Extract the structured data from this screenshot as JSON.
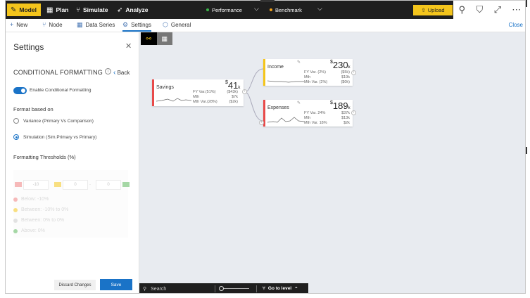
{
  "toolbar": {
    "model": "Model",
    "plan": "Plan",
    "simulate": "Simulate",
    "analyze": "Analyze",
    "performance": "Performance",
    "benchmark": "Benchmark",
    "upload": "Upload",
    "colors": {
      "accent": "#f4c51c",
      "performance_dot": "#3bb54a",
      "benchmark_dot": "#f4a21c"
    }
  },
  "window_icons": [
    "pin-icon",
    "filter-icon",
    "expand-icon",
    "more-icon"
  ],
  "subbar": {
    "new": "New",
    "node": "Node",
    "data_series": "Data Series",
    "settings": "Settings",
    "general": "General",
    "close": "Close"
  },
  "panel": {
    "title": "Settings",
    "section_title": "CONDITIONAL FORMATTING",
    "back": "Back",
    "enable_label": "Enable Conditional Formatting",
    "format_based_on": "Format based on",
    "option_variance": "Variance (Primary Vs Comparison)",
    "option_simulation": "Simulation (Sim.Primary vs Primary)",
    "thresholds_label": "Formatting Thresholds (%)",
    "threshold_inputs": [
      "-10",
      "0",
      "0"
    ],
    "legend": [
      "Below: -10%",
      "Between: -10% to 0%",
      "Between: 0% to 0%",
      "Above: 0%"
    ],
    "legend_colors": [
      "#f08080",
      "#f4c51c",
      "#cccccc",
      "#5cb85c"
    ],
    "discard": "Discard Changes",
    "save": "Save"
  },
  "nodes": {
    "savings": {
      "label": "Savings",
      "value": "41",
      "unit": "k",
      "currency": "$",
      "rows": [
        [
          "FY Var.(51%)",
          "($43k)"
        ],
        [
          "Mth",
          "$7k"
        ],
        [
          "Mth Var.(28%)",
          "($2k)"
        ]
      ],
      "bar_color": "#e84a4a"
    },
    "income": {
      "label": "Income",
      "value": "230",
      "unit": "k",
      "currency": "$",
      "rows": [
        [
          "FY Var. (2%)",
          "($5k)"
        ],
        [
          "Mth",
          "$19k"
        ],
        [
          "Mth Var. (2%)",
          "($0k)"
        ]
      ],
      "bar_color": "#f4c51c"
    },
    "expenses": {
      "label": "Expenses",
      "value": "189",
      "unit": "k",
      "currency": "$",
      "rows": [
        [
          "FY Var. 24%",
          "$37k"
        ],
        [
          "Mth",
          "$13k"
        ],
        [
          "Mth Var. 18%",
          "$2k"
        ]
      ],
      "bar_color": "#e84a4a"
    }
  },
  "bottombar": {
    "search_placeholder": "Search",
    "go_to_level": "Go to level"
  }
}
